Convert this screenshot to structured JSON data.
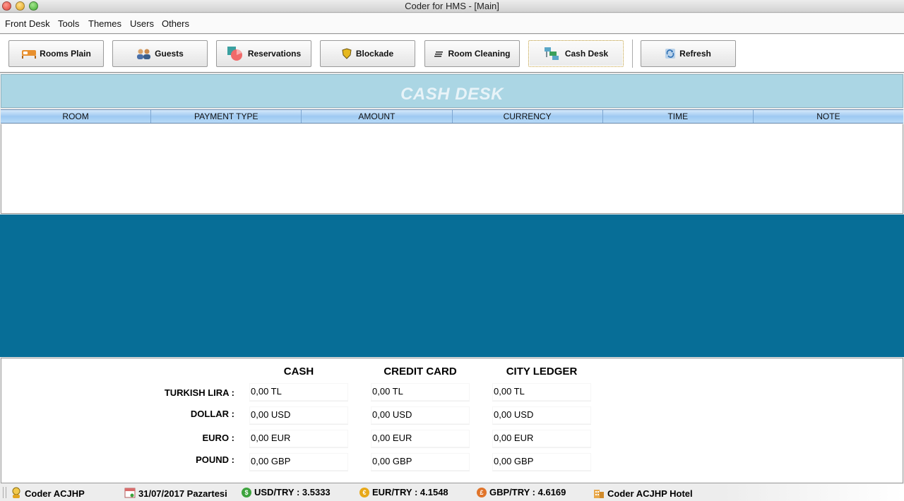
{
  "window": {
    "title": "Coder for HMS - [Main]"
  },
  "menu": [
    "Front Desk",
    "Tools",
    "Themes",
    "Users",
    "Others"
  ],
  "toolbar": {
    "rooms_plain": "Rooms Plain",
    "guests": "Guests",
    "reservations": "Reservations",
    "blockade": "Blockade",
    "room_cleaning": "Room Cleaning",
    "cash_desk": "Cash Desk",
    "refresh": "Refresh"
  },
  "panel": {
    "title": "CASH DESK"
  },
  "table": {
    "columns": [
      "ROOM",
      "PAYMENT TYPE",
      "AMOUNT",
      "CURRENCY",
      "TIME",
      "NOTE"
    ],
    "rows": []
  },
  "summary": {
    "columns": [
      "CASH",
      "CREDIT CARD",
      "CITY LEDGER"
    ],
    "rows": [
      {
        "label": "TURKISH LIRA :",
        "cash": "0,00 TL",
        "credit_card": "0,00 TL",
        "city_ledger": "0,00 TL"
      },
      {
        "label": "DOLLAR :",
        "cash": "0,00 USD",
        "credit_card": "0,00 USD",
        "city_ledger": "0,00 USD"
      },
      {
        "label": "EURO :",
        "cash": "0,00 EUR",
        "credit_card": "0,00 EUR",
        "city_ledger": "0,00 EUR"
      },
      {
        "label": "POUND :",
        "cash": "0,00 GBP",
        "credit_card": "0,00 GBP",
        "city_ledger": "0,00 GBP"
      }
    ]
  },
  "status": {
    "user": "Coder ACJHP",
    "date": "31/07/2017 Pazartesi",
    "usd": "USD/TRY : 3.5333",
    "eur": "EUR/TRY : 4.1548",
    "gbp": "GBP/TRY : 4.6169",
    "hotel": "Coder ACJHP Hotel"
  },
  "colors": {
    "accent_blue": "#076e97",
    "header_panel": "#abd6e4",
    "usd_badge": "#3da33d",
    "eur_badge": "#e8a818",
    "gbp_badge": "#e0742a"
  }
}
